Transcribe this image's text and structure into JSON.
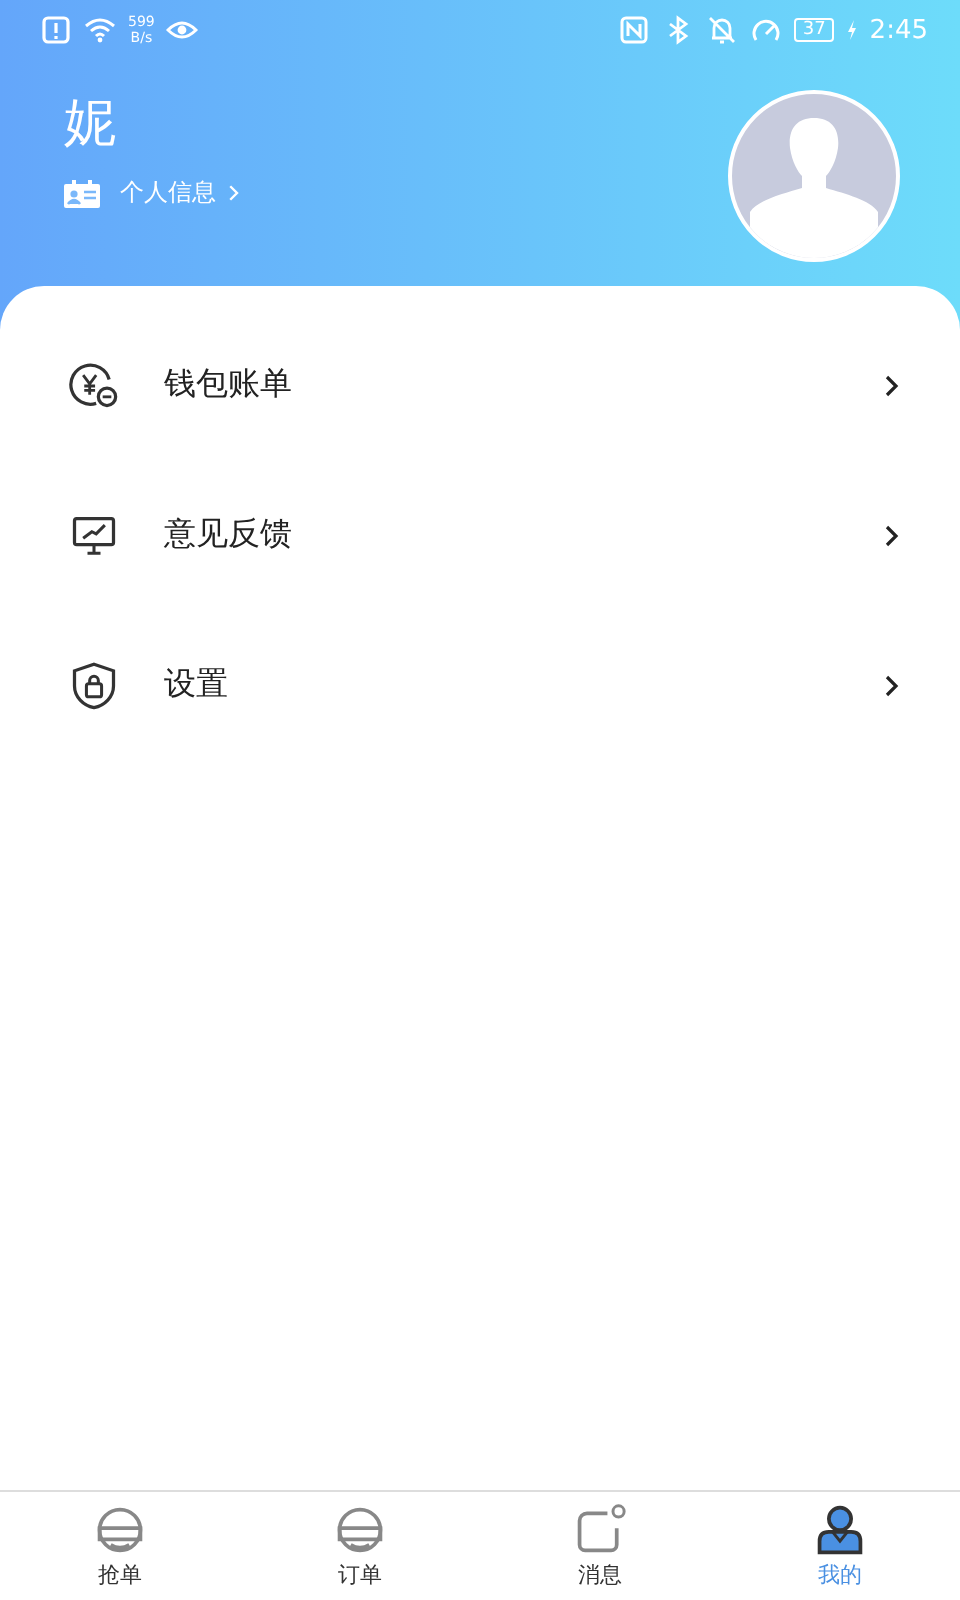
{
  "status_bar": {
    "speed_value": "599",
    "speed_unit": "B/s",
    "battery": "37",
    "time": "2:45"
  },
  "profile": {
    "name": "妮",
    "info_link": "个人信息"
  },
  "menu": [
    {
      "kind": "wallet",
      "label": "钱包账单"
    },
    {
      "kind": "feedback",
      "label": "意见反馈"
    },
    {
      "kind": "settings",
      "label": "设置"
    }
  ],
  "tabs": [
    {
      "kind": "grab",
      "label": "抢单",
      "selected": false
    },
    {
      "kind": "orders",
      "label": "订单",
      "selected": false
    },
    {
      "kind": "messages",
      "label": "消息",
      "selected": false
    },
    {
      "kind": "mine",
      "label": "我的",
      "selected": true
    }
  ]
}
